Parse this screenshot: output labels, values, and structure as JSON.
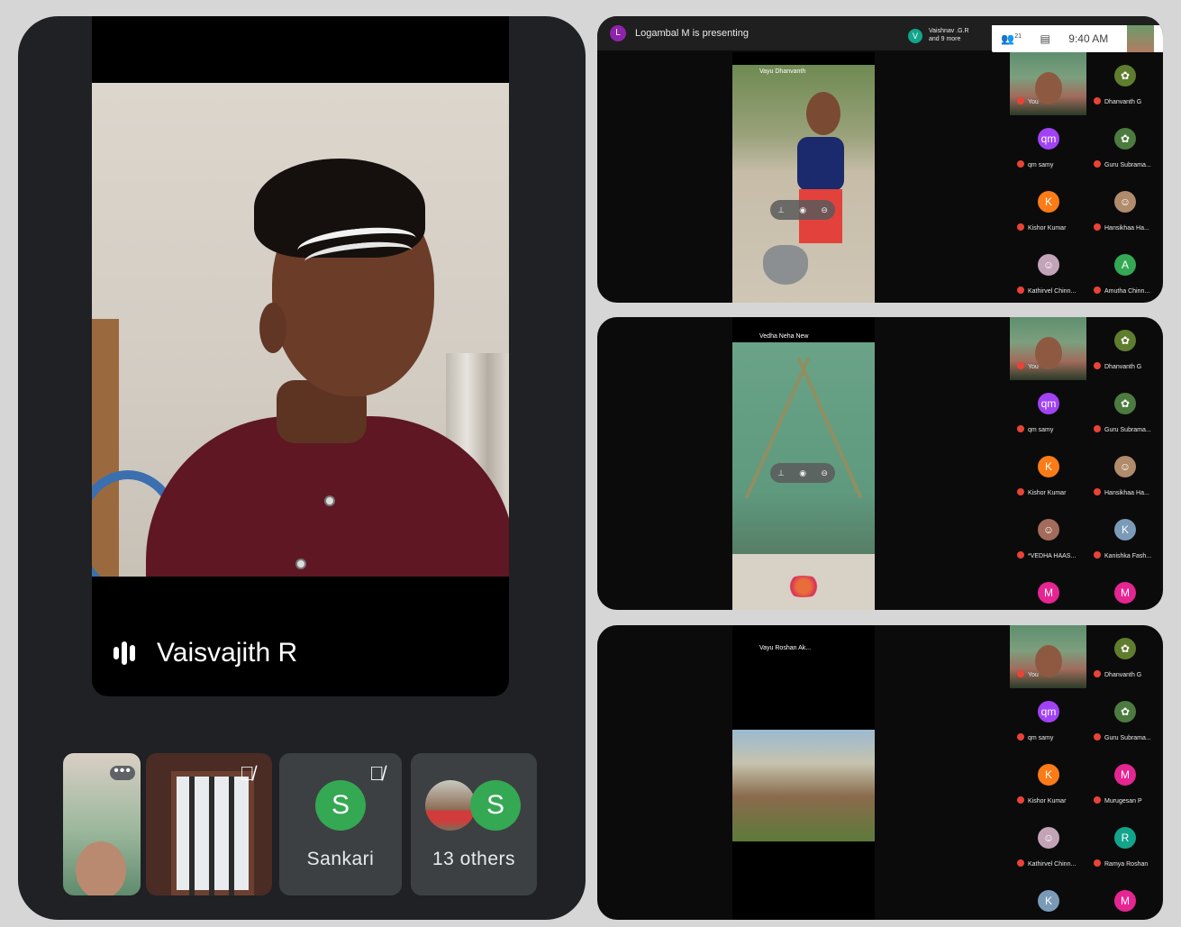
{
  "left": {
    "speaker_name": "Vaisvajith R",
    "self_more": "•••",
    "sankari_initial": "S",
    "sankari_name": "Sankari",
    "others_initial": "S",
    "others_label": "13 others"
  },
  "top_bar": {
    "presenter_initial": "L",
    "presenting_text": "Logambal M is presenting",
    "viewer_initial": "V",
    "viewer_line1": "Vaishnav .G.R",
    "viewer_line2": "and 9 more",
    "time": "9:40 AM",
    "participants_count": "21"
  },
  "panels": [
    {
      "shared_title": "Vayu Dhanvanth",
      "participants": [
        {
          "initial": "",
          "name": "You",
          "color": "",
          "self": true
        },
        {
          "initial": "✿",
          "name": "Dhanvanth G",
          "color": "#5f7d2e"
        },
        {
          "initial": "qm",
          "name": "qm samy",
          "color": "#a142f4"
        },
        {
          "initial": "✿",
          "name": "Guru Subrama...",
          "color": "#4c7b3f"
        },
        {
          "initial": "K",
          "name": "Kishor Kumar",
          "color": "#fa7b17"
        },
        {
          "initial": "☺",
          "name": "Hansikhaa Ha...",
          "color": "#b08b6c"
        },
        {
          "initial": "☺",
          "name": "Kathirvel Chinn...",
          "color": "#c3a3b8"
        },
        {
          "initial": "A",
          "name": "Amutha Chinn...",
          "color": "#34a853"
        }
      ]
    },
    {
      "shared_title": "Vedha Neha New",
      "participants": [
        {
          "initial": "",
          "name": "You",
          "color": "",
          "self": true
        },
        {
          "initial": "✿",
          "name": "Dhanvanth G",
          "color": "#5f7d2e"
        },
        {
          "initial": "qm",
          "name": "qm samy",
          "color": "#a142f4"
        },
        {
          "initial": "✿",
          "name": "Guru Subrama...",
          "color": "#4c7b3f"
        },
        {
          "initial": "K",
          "name": "Kishor Kumar",
          "color": "#fa7b17"
        },
        {
          "initial": "☺",
          "name": "Hansikhaa Ha...",
          "color": "#b08b6c"
        },
        {
          "initial": "☺",
          "name": "*VEDHA HAAS...",
          "color": "#a36b5b"
        },
        {
          "initial": "K",
          "name": "Kanishka Fash...",
          "color": "#7a9ab8"
        },
        {
          "initial": "M",
          "name": "",
          "color": "#e52592"
        },
        {
          "initial": "M",
          "name": "",
          "color": "#e52592"
        }
      ]
    },
    {
      "shared_title": "Vayu Roshan Ak...",
      "participants": [
        {
          "initial": "",
          "name": "You",
          "color": "",
          "self": true
        },
        {
          "initial": "✿",
          "name": "Dhanvanth G",
          "color": "#5f7d2e"
        },
        {
          "initial": "qm",
          "name": "qm samy",
          "color": "#a142f4"
        },
        {
          "initial": "✿",
          "name": "Guru Subrama...",
          "color": "#4c7b3f"
        },
        {
          "initial": "K",
          "name": "Kishor Kumar",
          "color": "#fa7b17"
        },
        {
          "initial": "M",
          "name": "Murugesan P",
          "color": "#e52592"
        },
        {
          "initial": "☺",
          "name": "Kathirvel Chinn...",
          "color": "#c3a3b8"
        },
        {
          "initial": "R",
          "name": "Ramya Roshan",
          "color": "#12a58c"
        },
        {
          "initial": "K",
          "name": "",
          "color": "#7a9ab8"
        },
        {
          "initial": "M",
          "name": "",
          "color": "#e52592"
        }
      ]
    }
  ]
}
